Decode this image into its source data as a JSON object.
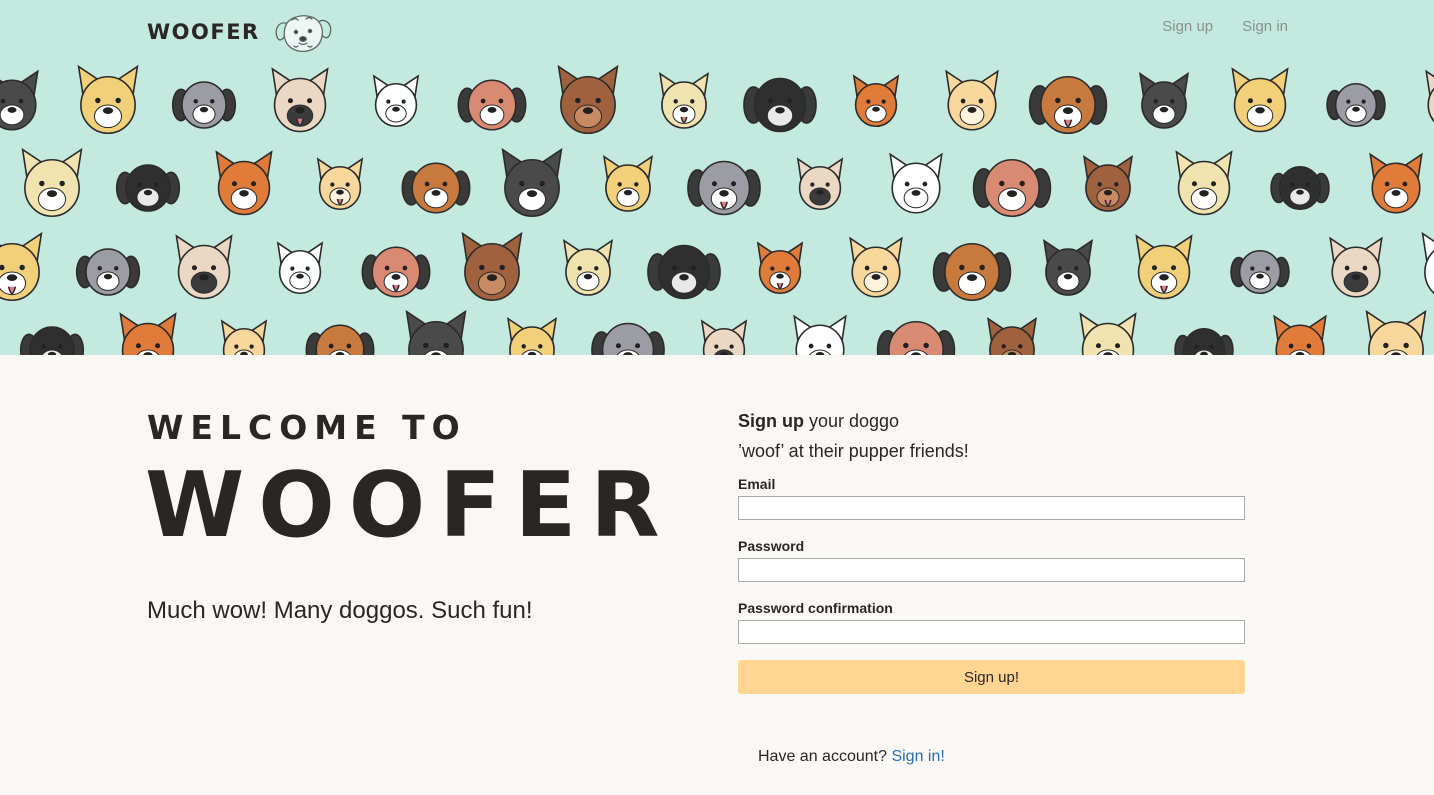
{
  "brand": {
    "name": "WOOFER",
    "logo_icon": "dog-head-logo-icon"
  },
  "nav": {
    "signup": "Sign up",
    "signin": "Sign in"
  },
  "hero": {
    "welcome": "WELCOME TO",
    "title": "WOOFER",
    "tagline": "Much wow! Many doggos. Such fun!",
    "pattern": "dog-faces-pattern",
    "background_color": "#c4e9df"
  },
  "form": {
    "intro_bold": "Sign up",
    "intro_rest": " your doggo",
    "intro_line2": "’woof’ at their pupper friends!",
    "email_label": "Email",
    "email_value": "",
    "password_label": "Password",
    "password_value": "",
    "confirm_label": "Password confirmation",
    "confirm_value": "",
    "submit_label": "Sign up!",
    "submit_color": "#ffd591"
  },
  "footer": {
    "have_account": "Have an account?",
    "signin_link": "Sign in!",
    "link_color": "#2a6eb0"
  }
}
